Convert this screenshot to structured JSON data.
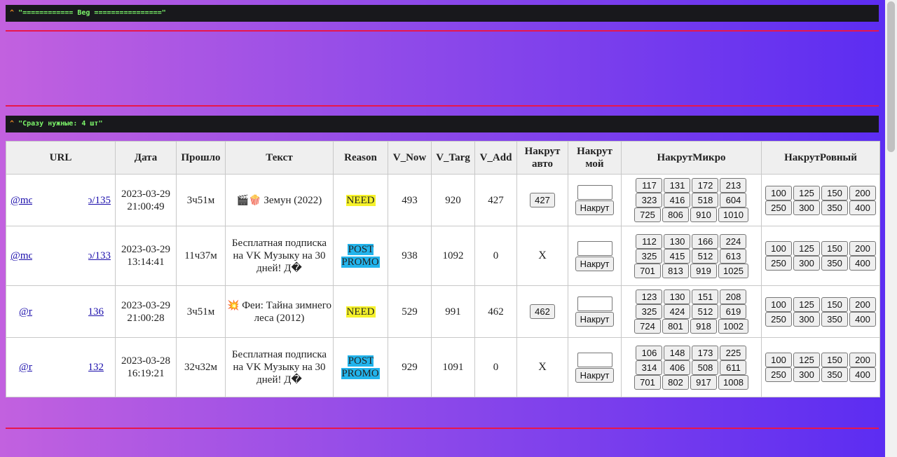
{
  "header": {
    "caret": "^",
    "beg_text": "\"============ Beg ================\"",
    "need_text": "\"Сразу нужные: 4 шт\""
  },
  "table": {
    "columns": [
      "URL",
      "Дата",
      "Прошло",
      "Текст",
      "Reason",
      "V_Now",
      "V_Targ",
      "V_Add",
      "Накрут авто",
      "Накрут мой",
      "НакрутМикро",
      "НакрутРовный"
    ],
    "button_label": "Накрут",
    "rows": [
      {
        "url_left": "@mc",
        "url_right": "o/135",
        "date": "2023-03-29",
        "time": "21:00:49",
        "elapsed": "3ч51м",
        "text_icon": "🎬🍿",
        "text": "Земун (2022)",
        "reason": "NEED",
        "reason_type": "need",
        "v_now": "493",
        "v_targ": "920",
        "v_add": "427",
        "auto": "427",
        "micro": [
          [
            "117",
            "131",
            "172",
            "213"
          ],
          [
            "323",
            "416",
            "518",
            "604"
          ],
          [
            "725",
            "806",
            "910",
            "1010"
          ]
        ],
        "even": [
          [
            "100",
            "125",
            "150",
            "200"
          ],
          [
            "250",
            "300",
            "350",
            "400"
          ]
        ]
      },
      {
        "url_left": "@mc",
        "url_right": "o/133",
        "date": "2023-03-29",
        "time": "13:14:41",
        "elapsed": "11ч37м",
        "text_icon": "",
        "text": "Бесплатная подписка на VK Музыку на 30 дней! Д�",
        "reason": "POST PROMO",
        "reason_type": "promo",
        "v_now": "938",
        "v_targ": "1092",
        "v_add": "0",
        "auto": "X",
        "micro": [
          [
            "112",
            "130",
            "166",
            "224"
          ],
          [
            "325",
            "415",
            "512",
            "613"
          ],
          [
            "701",
            "813",
            "919",
            "1025"
          ]
        ],
        "even": [
          [
            "100",
            "125",
            "150",
            "200"
          ],
          [
            "250",
            "300",
            "350",
            "400"
          ]
        ]
      },
      {
        "url_left": "@n",
        "url_right": "136",
        "date": "2023-03-29",
        "time": "21:00:28",
        "elapsed": "3ч51м",
        "text_icon": "💥",
        "text": "Феи: Тайна зимнего леса (2012)",
        "reason": "NEED",
        "reason_type": "need",
        "v_now": "529",
        "v_targ": "991",
        "v_add": "462",
        "auto": "462",
        "micro": [
          [
            "123",
            "130",
            "151",
            "208"
          ],
          [
            "325",
            "424",
            "512",
            "619"
          ],
          [
            "724",
            "801",
            "918",
            "1002"
          ]
        ],
        "even": [
          [
            "100",
            "125",
            "150",
            "200"
          ],
          [
            "250",
            "300",
            "350",
            "400"
          ]
        ]
      },
      {
        "url_left": "@n",
        "url_right": "132",
        "date": "2023-03-28",
        "time": "16:19:21",
        "elapsed": "32ч32м",
        "text_icon": "",
        "text": "Бесплатная подписка на VK Музыку на 30 дней! Д�",
        "reason": "POST PROMO",
        "reason_type": "promo",
        "v_now": "929",
        "v_targ": "1091",
        "v_add": "0",
        "auto": "X",
        "micro": [
          [
            "106",
            "148",
            "173",
            "225"
          ],
          [
            "314",
            "406",
            "508",
            "611"
          ],
          [
            "701",
            "802",
            "917",
            "1008"
          ]
        ],
        "even": [
          [
            "100",
            "125",
            "150",
            "200"
          ],
          [
            "250",
            "300",
            "350",
            "400"
          ]
        ]
      }
    ]
  },
  "colors": {
    "bar_bg": "#18181c",
    "caret": "#f08a24",
    "bar_text": "#7cf56a",
    "divider": "#e8174b",
    "need": "#f6f22a",
    "promo": "#22b4ec"
  }
}
